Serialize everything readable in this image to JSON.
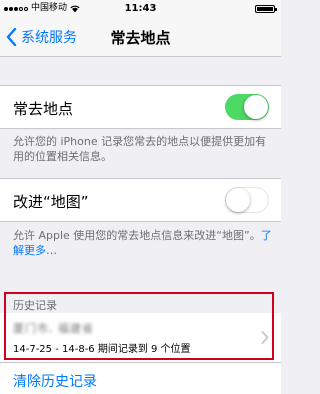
{
  "status_bar": {
    "carrier": "中国移动",
    "time": "11:43",
    "signal_bars_filled": 3,
    "signal_bars_total": 5,
    "battery_level": 1.0
  },
  "nav": {
    "back_label": "系统服务",
    "title": "常去地点"
  },
  "frequent_locations": {
    "label": "常去地点",
    "enabled": true,
    "footer": "允许您的 iPhone 记录您常去的地点以便提供更加有用的位置相关信息。"
  },
  "improve_maps": {
    "label": "改进“地图”",
    "enabled": false,
    "footer": "允许 Apple 使用您的常去地点信息来改进“地图”。",
    "learn_more": "了解更多…"
  },
  "history": {
    "header": "历史记录",
    "place": "厦门市, 福建省",
    "range": "14-7-25 - 14-8-6 期间记录到 9 个位置"
  },
  "clear_history_label": "清除历史记录",
  "colors": {
    "accent": "#007aff",
    "toggle_on": "#4cd964",
    "highlight": "#d0021b",
    "background": "#efeff4"
  }
}
